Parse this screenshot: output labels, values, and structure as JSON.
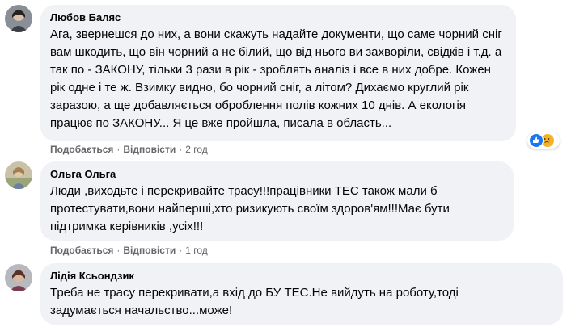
{
  "comments": [
    {
      "author": "Любов Баляс",
      "lines": [
        "Ага, звернешся до них, а вони скажуть надайте документи, що саме чорний сніг",
        "вам шкодить, що він чорний а не білий, що від нього ви захворіли, свідків і т.д. а",
        "так по - ЗАКОНУ, тільки 3 рази в рік - зроблять аналіз і все в них добре. Кожен",
        "рік одне і те ж. Взимку видно, бо чорний сніг, а літом? Дихаємо круглий рік",
        "заразою, а ще добавляється оброблення полів кожних 10 днів. А екологія",
        "працює по ЗАКОНУ... Я це вже пройшла, писала в область..."
      ],
      "like_label": "Подобається",
      "reply_label": "Відповісти",
      "time": "2 год",
      "reactions": [
        "like-icon",
        "sad-icon"
      ]
    },
    {
      "author": "Ольга Ольга",
      "lines": [
        "Люди ,виходьте і перекривайте трасу!!!працівники ТЕС також мали б",
        "протестувати,вони найперші,хто ризикують своїм здоров'ям!!!Має бути",
        "підтримка керівників ,усіх!!!"
      ],
      "like_label": "Подобається",
      "reply_label": "Відповісти",
      "time": "1 год"
    },
    {
      "author": "Лідія Ксьондзик",
      "lines": [
        "Треба не трасу перекривати,а вхід до БУ ТЕС.Не вийдуть на роботу,тоді",
        "задумається начальство...може!"
      ]
    }
  ],
  "colors": {
    "bubble": "#f0f2f5",
    "meta": "#65676b",
    "like": "#1877f2",
    "sad": "#f7b125"
  }
}
